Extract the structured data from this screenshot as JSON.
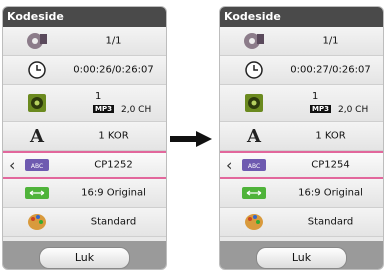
{
  "panels": [
    {
      "title": "Kodeside",
      "title_number": "1/1",
      "time": "0:00:26/0:26:07",
      "audio": {
        "track": "1",
        "codec": "MP3",
        "channels": "2,0 CH"
      },
      "subtitle_lang": "1 KOR",
      "code_page": "CP1252",
      "aspect": "16:9 Original",
      "picture_mode": "Standard",
      "close_label": "Luk"
    },
    {
      "title": "Kodeside",
      "title_number": "1/1",
      "time": "0:00:27/0:26:07",
      "audio": {
        "track": "1",
        "codec": "MP3",
        "channels": "2,0 CH"
      },
      "subtitle_lang": "1 KOR",
      "code_page": "CP1254",
      "aspect": "16:9 Original",
      "picture_mode": "Standard",
      "close_label": "Luk"
    }
  ],
  "icons": {
    "disc": "disc-icon",
    "clock": "clock-icon",
    "speaker": "speaker-icon",
    "subtitle": "font-a-icon",
    "codepage": "abc-icon",
    "aspect": "aspect-ratio-icon",
    "picture": "palette-icon"
  },
  "colors": {
    "selected_border": "#e2679c",
    "title_bar": "#4a4a4a"
  }
}
